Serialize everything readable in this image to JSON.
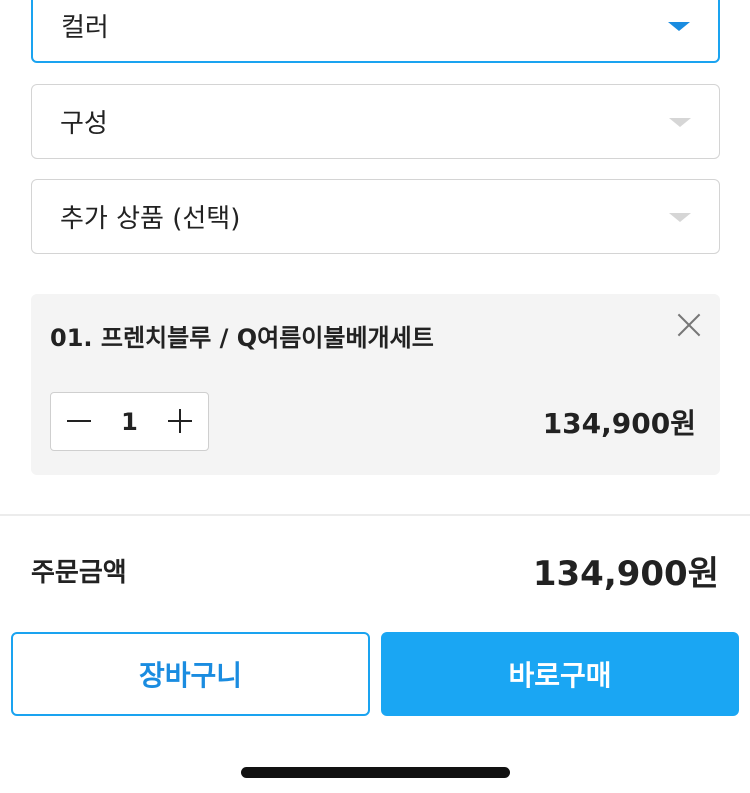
{
  "options": {
    "color": {
      "label": "컬러"
    },
    "composition": {
      "label": "구성"
    },
    "addon": {
      "label": "추가 상품 (선택)"
    }
  },
  "selected_item": {
    "title": "01. 프렌치블루 / Q여름이불베개세트",
    "quantity": "1",
    "price": "134,900원"
  },
  "summary": {
    "label": "주문금액",
    "total": "134,900원"
  },
  "actions": {
    "cart_label": "장바구니",
    "buy_label": "바로구매"
  },
  "colors": {
    "accent": "#1aa3f0",
    "buy_button": "#1aa6f3"
  }
}
